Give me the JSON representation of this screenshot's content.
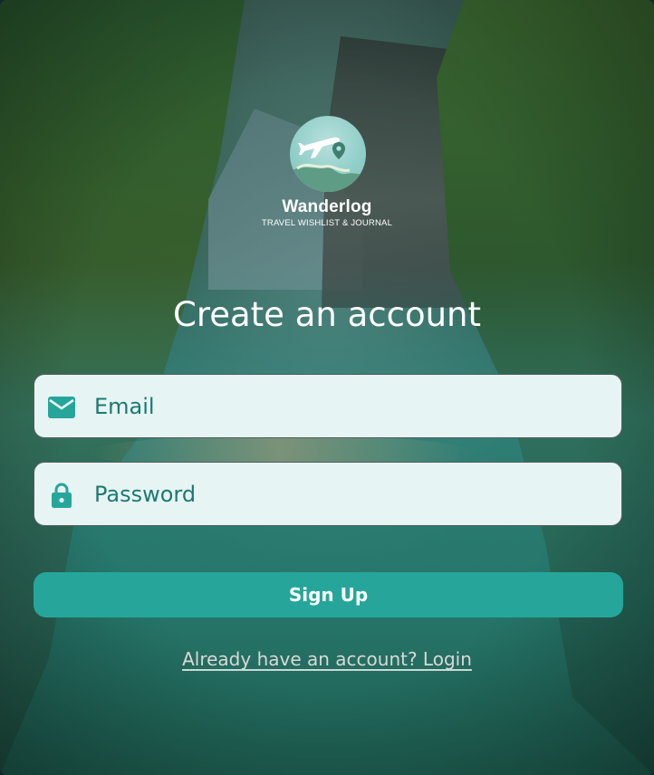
{
  "brand": {
    "name": "Wanderlog",
    "tagline": "TRAVEL WISHLIST & JOURNAL",
    "logo_icon": "airplane-map-pin-icon"
  },
  "form": {
    "title": "Create an account",
    "email": {
      "placeholder": "Email",
      "icon": "mail-icon"
    },
    "password": {
      "placeholder": "Password",
      "icon": "lock-icon"
    },
    "submit_label": "Sign Up",
    "login_prompt": "Already have an account? Login"
  },
  "colors": {
    "accent": "#26a69a",
    "field_bg": "#e6f4f4",
    "field_text": "#1c7a70",
    "text_light": "#ffffff"
  }
}
